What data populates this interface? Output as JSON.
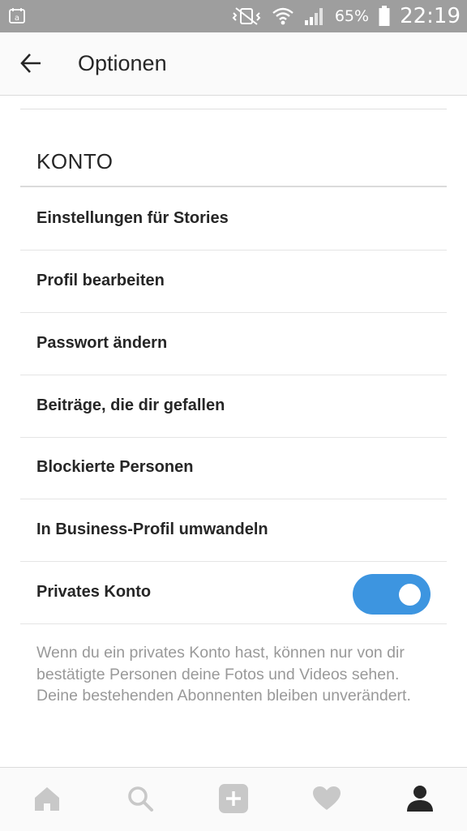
{
  "status_bar": {
    "battery_percent": "65%",
    "time": "22:19",
    "icons": [
      "calendar-notification-icon",
      "vibrate-mute-icon",
      "wifi-icon",
      "signal-icon",
      "battery-icon"
    ]
  },
  "header": {
    "title": "Optionen",
    "back_icon": "arrow-left-icon"
  },
  "section": {
    "heading": "KONTO"
  },
  "menu_items": [
    {
      "label": "Einstellungen für Stories"
    },
    {
      "label": "Profil bearbeiten"
    },
    {
      "label": "Passwort ändern"
    },
    {
      "label": "Beiträge, die dir gefallen"
    },
    {
      "label": "Blockierte Personen"
    },
    {
      "label": "In Business-Profil umwandeln"
    }
  ],
  "private_account": {
    "label": "Privates Konto",
    "enabled": true,
    "description": "Wenn du ein privates Konto hast, können nur von dir bestätigte Personen deine Fotos und Videos sehen. Deine bestehenden Abonnenten bleiben unverändert."
  },
  "bottom_nav": {
    "items": [
      "home-icon",
      "search-icon",
      "add-post-icon",
      "activity-heart-icon",
      "profile-icon"
    ],
    "active": "profile-icon"
  },
  "colors": {
    "toggle_on": "#3d95e0",
    "status_bar": "#9e9e9e",
    "text_primary": "#262626",
    "text_secondary": "#999999"
  }
}
